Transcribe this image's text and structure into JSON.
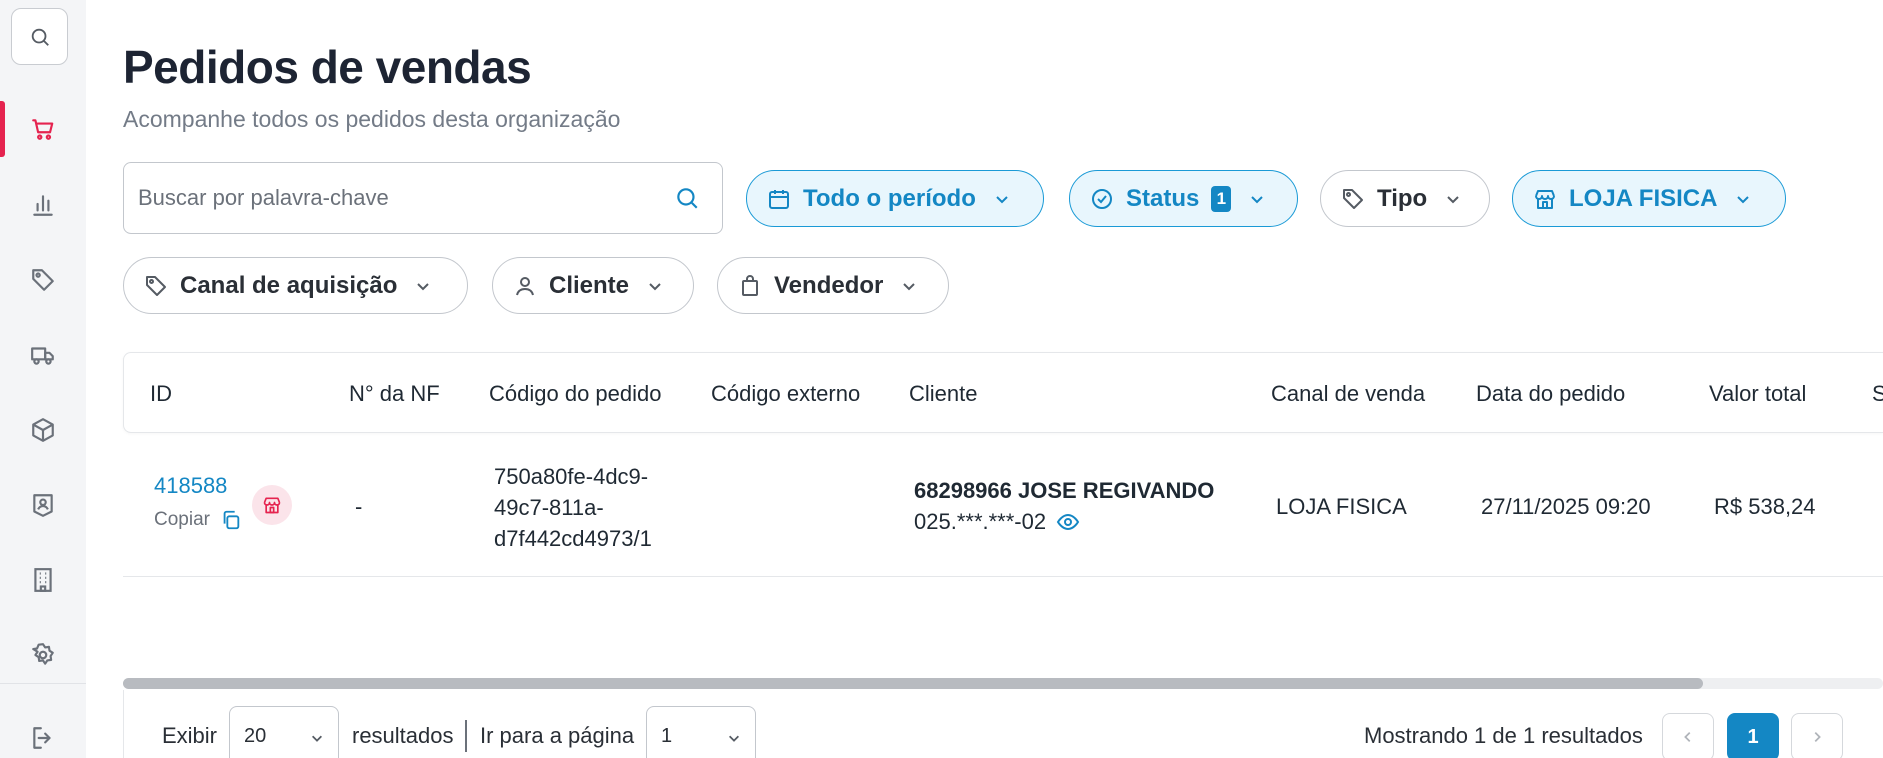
{
  "header": {
    "title": "Pedidos de vendas",
    "subtitle": "Acompanhe todos os pedidos desta organização"
  },
  "search": {
    "placeholder": "Buscar por palavra-chave"
  },
  "filters": {
    "period": "Todo o período",
    "status": "Status",
    "status_count": "1",
    "type": "Tipo",
    "store": "LOJA FISICA",
    "channel": "Canal de aquisição",
    "client": "Cliente",
    "seller": "Vendedor"
  },
  "table": {
    "columns": [
      "ID",
      "N° da NF",
      "Código do pedido",
      "Código externo",
      "Cliente",
      "Canal de venda",
      "Data do pedido",
      "Valor total",
      "S"
    ],
    "rows": [
      {
        "id": "418588",
        "copy_label": "Copiar",
        "nf": "-",
        "order_code_lines": [
          "750a80fe-4dc9-",
          "49c7-811a-",
          "d7f442cd4973/1"
        ],
        "external_code": "",
        "client_name": "68298966 JOSE REGIVANDO",
        "client_doc": "025.***.***-02",
        "channel": "LOJA FISICA",
        "date": "27/11/2025 09:20",
        "total": "R$ 538,24"
      }
    ]
  },
  "footer": {
    "show_label": "Exibir",
    "page_size": "20",
    "results_label": "resultados",
    "goto_label": "Ir para a página",
    "goto_page": "1",
    "summary": "Mostrando 1 de 1 resultados",
    "current_page": "1"
  },
  "colors": {
    "accent": "#1487c4",
    "active_nav": "#e5234f",
    "sidebar_bg": "#f4f5f7"
  },
  "sidebar": {
    "items": [
      {
        "icon": "cart-icon",
        "active": true
      },
      {
        "icon": "bar-chart-icon",
        "active": false
      },
      {
        "icon": "tag-icon",
        "active": false
      },
      {
        "icon": "truck-icon",
        "active": false
      },
      {
        "icon": "box-icon",
        "active": false
      },
      {
        "icon": "user-badge-icon",
        "active": false
      },
      {
        "icon": "building-icon",
        "active": false
      },
      {
        "icon": "gear-icon",
        "active": false
      },
      {
        "icon": "logout-icon",
        "active": false
      }
    ]
  }
}
